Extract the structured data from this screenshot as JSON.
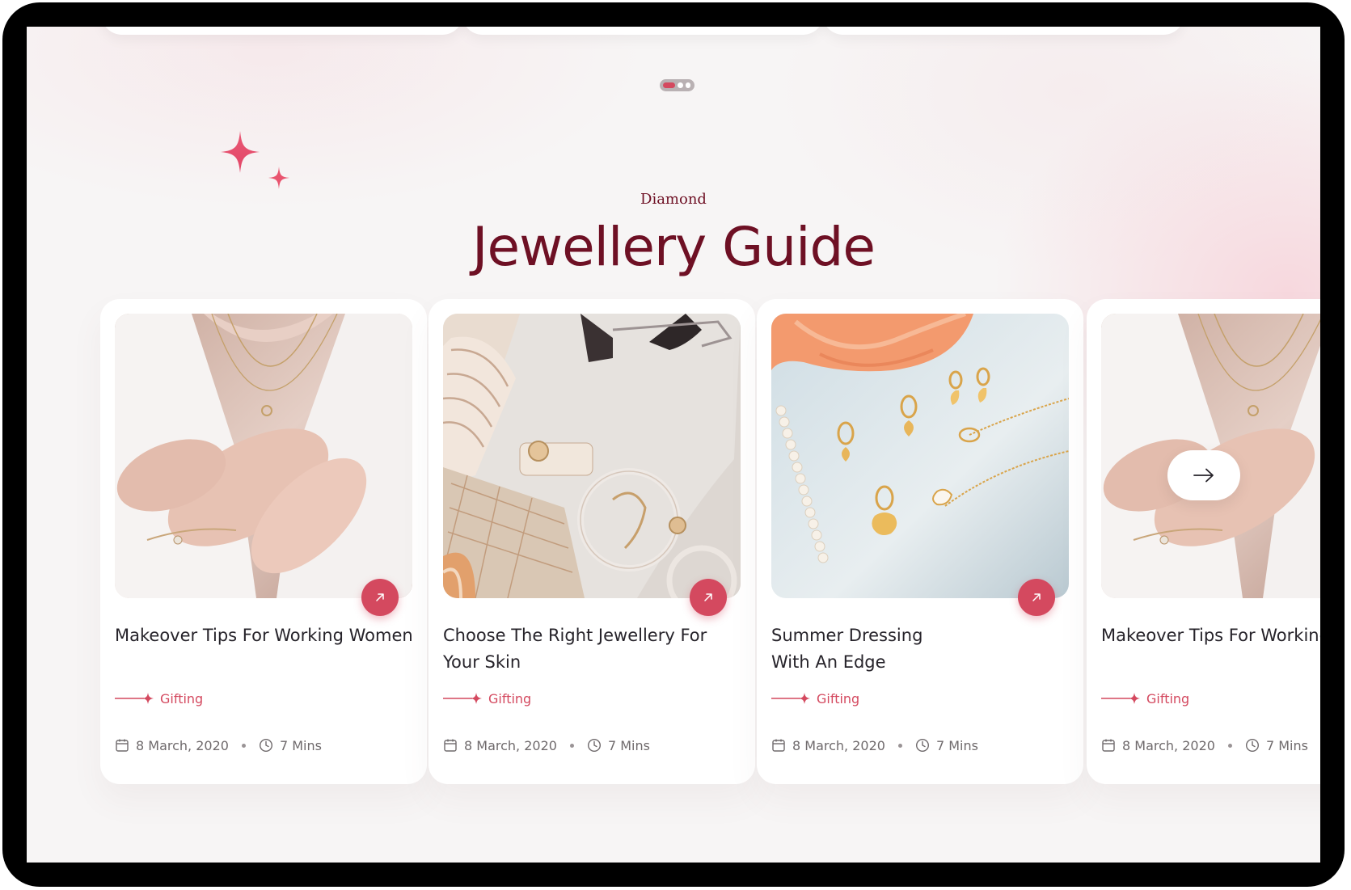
{
  "section": {
    "eyebrow": "Diamond",
    "title": "Jewellery Guide"
  },
  "colors": {
    "accent": "#d4495f",
    "heading": "#6e1024",
    "text": "#26232a",
    "muted": "#6f6a6c"
  },
  "pager": {
    "total": 3,
    "active": 1
  },
  "articles": [
    {
      "title": "Makeover Tips For Working Women",
      "category": "Gifting",
      "date": "8 March, 2020",
      "read_time": "7 Mins"
    },
    {
      "title": "Choose The Right Jewellery For Your Skin",
      "category": "Gifting",
      "date": "8 March, 2020",
      "read_time": "7 Mins"
    },
    {
      "title": "Summer Dressing With An Edge",
      "category": "Gifting",
      "date": "8 March, 2020",
      "read_time": "7 Mins"
    },
    {
      "title": "Makeover Tips For Working Women",
      "category": "Gifting",
      "date": "8 March, 2020",
      "read_time": "7 Mins"
    }
  ],
  "icons": {
    "sparkle": "sparkle-icon",
    "open": "arrow-up-right-icon",
    "calendar": "calendar-icon",
    "clock": "clock-icon",
    "next": "arrow-right-icon"
  }
}
